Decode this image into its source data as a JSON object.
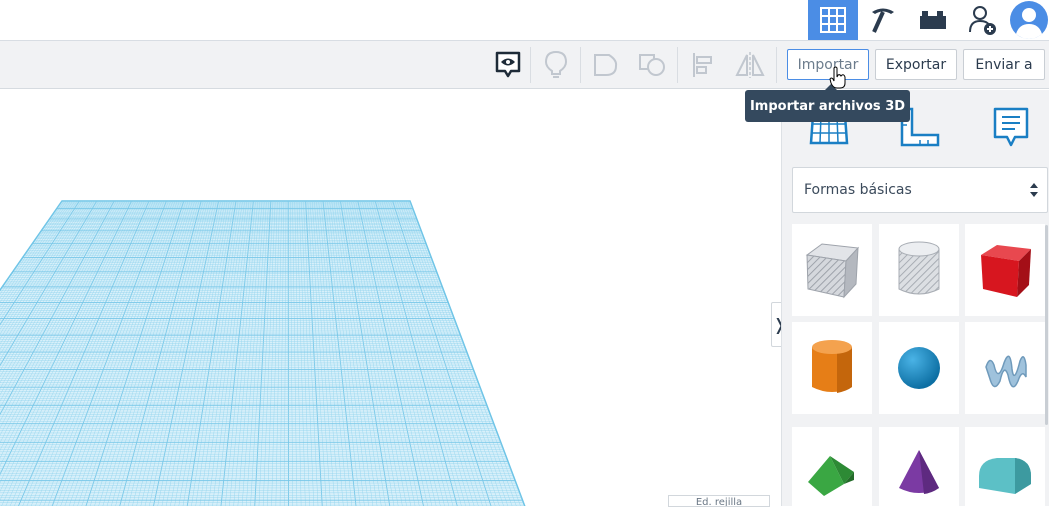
{
  "topbar": {
    "buttons": [
      {
        "name": "grid-view",
        "icon": "grid-icon",
        "active": true
      },
      {
        "name": "build",
        "icon": "pickaxe-icon",
        "active": false
      },
      {
        "name": "bricks",
        "icon": "brick-icon",
        "active": false
      },
      {
        "name": "add-user",
        "icon": "add-user-icon",
        "active": false
      },
      {
        "name": "profile",
        "icon": "avatar-icon",
        "active": false
      }
    ]
  },
  "toolbar": {
    "tools": [
      "comment-eye-icon",
      "lightbulb-icon",
      "group-icon",
      "ungroup-icon",
      "align-icon",
      "mirror-icon"
    ],
    "import_label": "Importar",
    "export_label": "Exportar",
    "send_label": "Enviar a"
  },
  "tooltip": {
    "text": "Importar archivos 3D"
  },
  "panel": {
    "icons": [
      "workplane-icon",
      "ruler-icon",
      "notes-icon"
    ],
    "category": "Formas básicas",
    "shapes": [
      {
        "name": "box-hole",
        "color": "#b8bcc4"
      },
      {
        "name": "cylinder-hole",
        "color": "#c4c8ce"
      },
      {
        "name": "box",
        "color": "#d7161f"
      },
      {
        "name": "cylinder",
        "color": "#e67e17"
      },
      {
        "name": "sphere",
        "color": "#1890c9"
      },
      {
        "name": "scribble",
        "color": "#9fc2dc"
      },
      {
        "name": "roof",
        "color": "#3aa743"
      },
      {
        "name": "cone",
        "color": "#7b3aa3"
      },
      {
        "name": "round-roof",
        "color": "#5cc0c6"
      }
    ]
  },
  "workplane": {
    "grid_label": "Ed. rejilla",
    "grid_color": "#8fd3ee"
  },
  "colors": {
    "accent": "#4b8de5",
    "tooltip_bg": "#34495e"
  }
}
